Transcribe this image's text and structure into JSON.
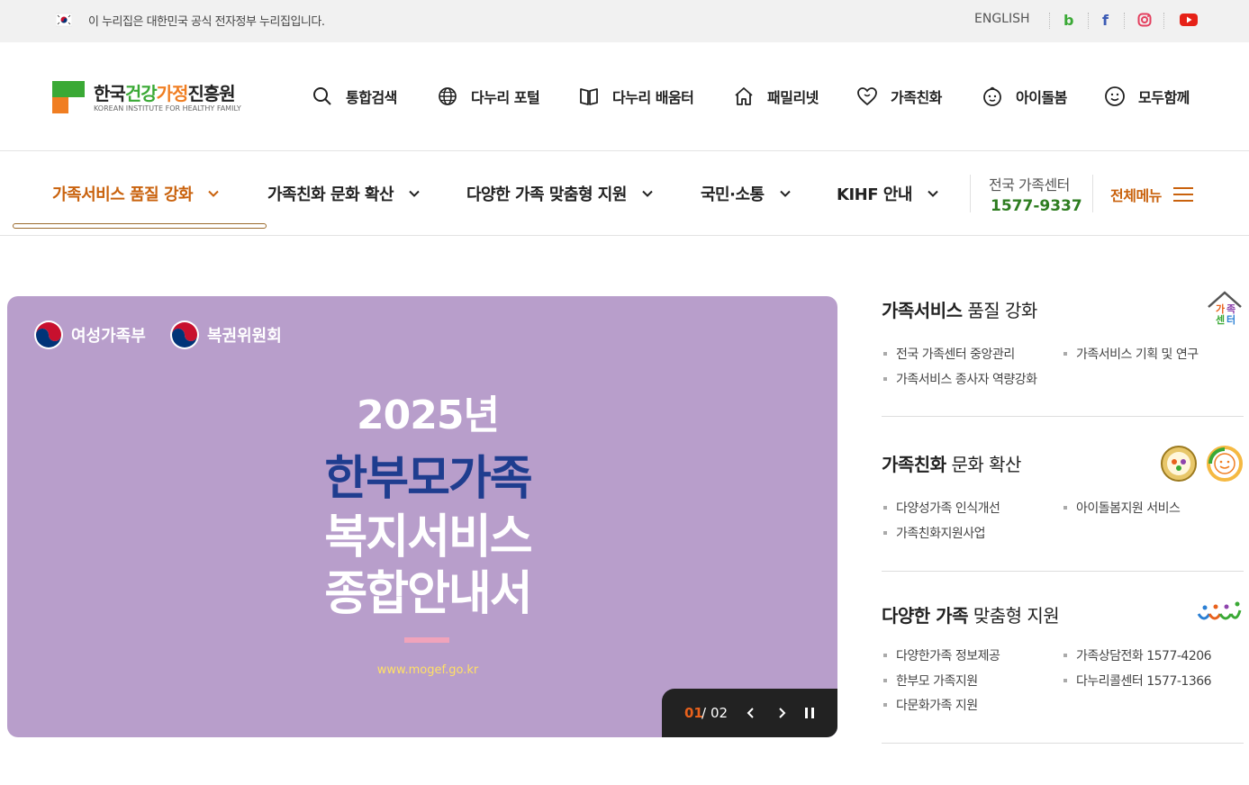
{
  "topbar": {
    "notice": "이 누리집은 대한민국 공식 전자정부 누리집입니다.",
    "english": "ENGLISH",
    "sns": [
      "blog-icon",
      "facebook-icon",
      "instagram-icon",
      "youtube-icon"
    ]
  },
  "logo": {
    "name_a": "한국",
    "name_b": "건강",
    "name_c": "가정",
    "name_d": "진흥원",
    "sub": "KOREAN INSTITUTE FOR HEALTHY FAMILY"
  },
  "util": {
    "search": "통합검색",
    "portal": "다누리 포털",
    "learning": "다누리 배움터",
    "familynet": "패밀리넷",
    "friendly": "가족친화",
    "childcare": "아이돌봄",
    "together": "모두함께"
  },
  "gnb": {
    "items": [
      "가족서비스 품질 강화",
      "가족친화 문화 확산",
      "다양한 가족 맞춤형 지원",
      "국민·소통",
      "KIHF 안내"
    ],
    "center_label": "전국 가족센터",
    "center_phone": "1577-9337",
    "all_menu": "전체메뉴"
  },
  "banner": {
    "org1": "여성가족부",
    "org2": "복권위원회",
    "year": "2025년",
    "title1": "한부모가족",
    "title2": "복지서비스",
    "title3": "종합안내서",
    "url": "www.mogef.go.kr",
    "current": "01",
    "slash": "/",
    "total": "02"
  },
  "side": {
    "s1": {
      "title_bold": "가족서비스",
      "title_rest": " 품질 강화",
      "items": [
        "전국 가족센터 중앙관리",
        "가족서비스 기획 및 연구",
        "가족서비스 종사자 역량강화"
      ]
    },
    "s2": {
      "title_bold": "가족친화",
      "title_rest": " 문화 확산",
      "items": [
        "다양성가족 인식개선",
        "아이돌봄지원 서비스",
        "가족친화지원사업"
      ]
    },
    "s3": {
      "title_bold": "다양한 가족",
      "title_rest": " 맞춤형 지원",
      "items": [
        "다양한가족 정보제공",
        "가족상담전화 1577-4206",
        "한부모 가족지원",
        "다누리콜센터 1577-1366",
        "다문화가족 지원"
      ]
    }
  },
  "colors": {
    "accent": "#c9620d",
    "green": "#2e7d20",
    "banner_bg": "#b89ecb",
    "banner_title": "#1f3d8f"
  }
}
